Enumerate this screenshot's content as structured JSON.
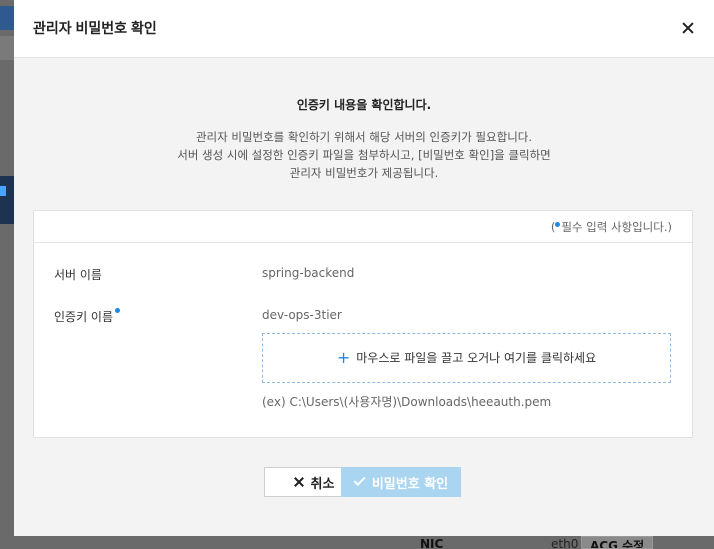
{
  "modal": {
    "title": "관리자 비밀번호 확인",
    "close_icon": "close-icon",
    "headline": "인증키 내용을 확인합니다.",
    "description_lines": [
      "관리자 비밀번호를 확인하기 위해서 해당 서버의 인증키가 필요합니다.",
      "서버 생성 시에 설정한 인증키 파일을 첨부하시고, [비밀번호 확인]을 클릭하면",
      "관리자 비밀번호가 제공됩니다."
    ],
    "required_note_prefix": "(",
    "required_note_text": "필수 입력 사항입니다.)",
    "server_name_label": "서버 이름",
    "server_name_value": "spring-backend",
    "auth_key_label": "인증키 이름",
    "auth_key_value": "dev-ops-3tier",
    "dropzone_text": "마우스로 파일을 끌고 오거나 여기를 클릭하세요",
    "dropzone_icon": "plus-icon",
    "path_hint": "(ex) C:\\Users\\(사용자명)\\Downloads\\heeauth.pem",
    "cancel_label": "취소",
    "confirm_label": "비밀번호 확인",
    "required_dot_color": "#1e88e5",
    "confirm_button_color": "#a9d5f1"
  },
  "background": {
    "nic_label": "NIC",
    "eth_value": "eth0",
    "acg_button": "ACG 수정"
  }
}
